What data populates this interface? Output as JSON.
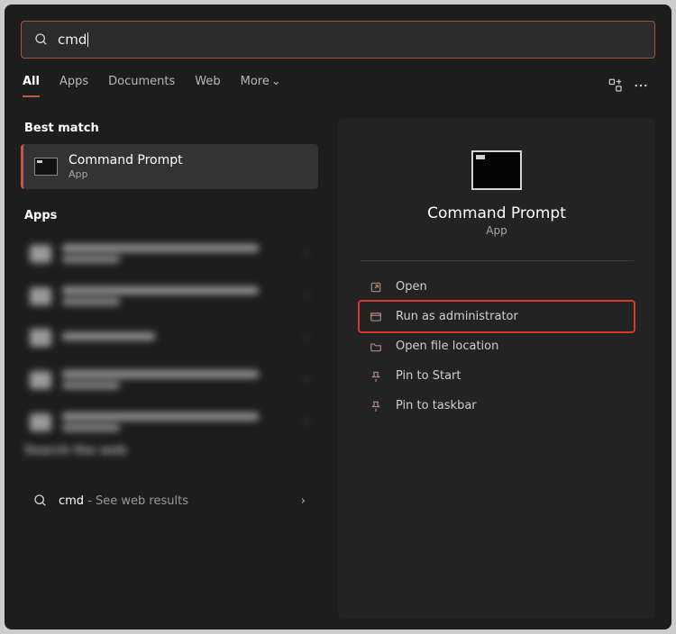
{
  "search": {
    "query": "cmd"
  },
  "tabs": {
    "items": [
      "All",
      "Apps",
      "Documents",
      "Web",
      "More"
    ],
    "active": 0
  },
  "sections": {
    "best_match": "Best match",
    "apps": "Apps",
    "search_web": "Search the web"
  },
  "best_match": {
    "title": "Command Prompt",
    "subtitle": "App"
  },
  "web_result": {
    "term": "cmd",
    "hint": " - See web results"
  },
  "preview": {
    "title": "Command Prompt",
    "subtitle": "App",
    "actions": {
      "open": "Open",
      "run_admin": "Run as administrator",
      "open_location": "Open file location",
      "pin_start": "Pin to Start",
      "pin_taskbar": "Pin to taskbar"
    },
    "highlighted_action": "run_admin"
  }
}
